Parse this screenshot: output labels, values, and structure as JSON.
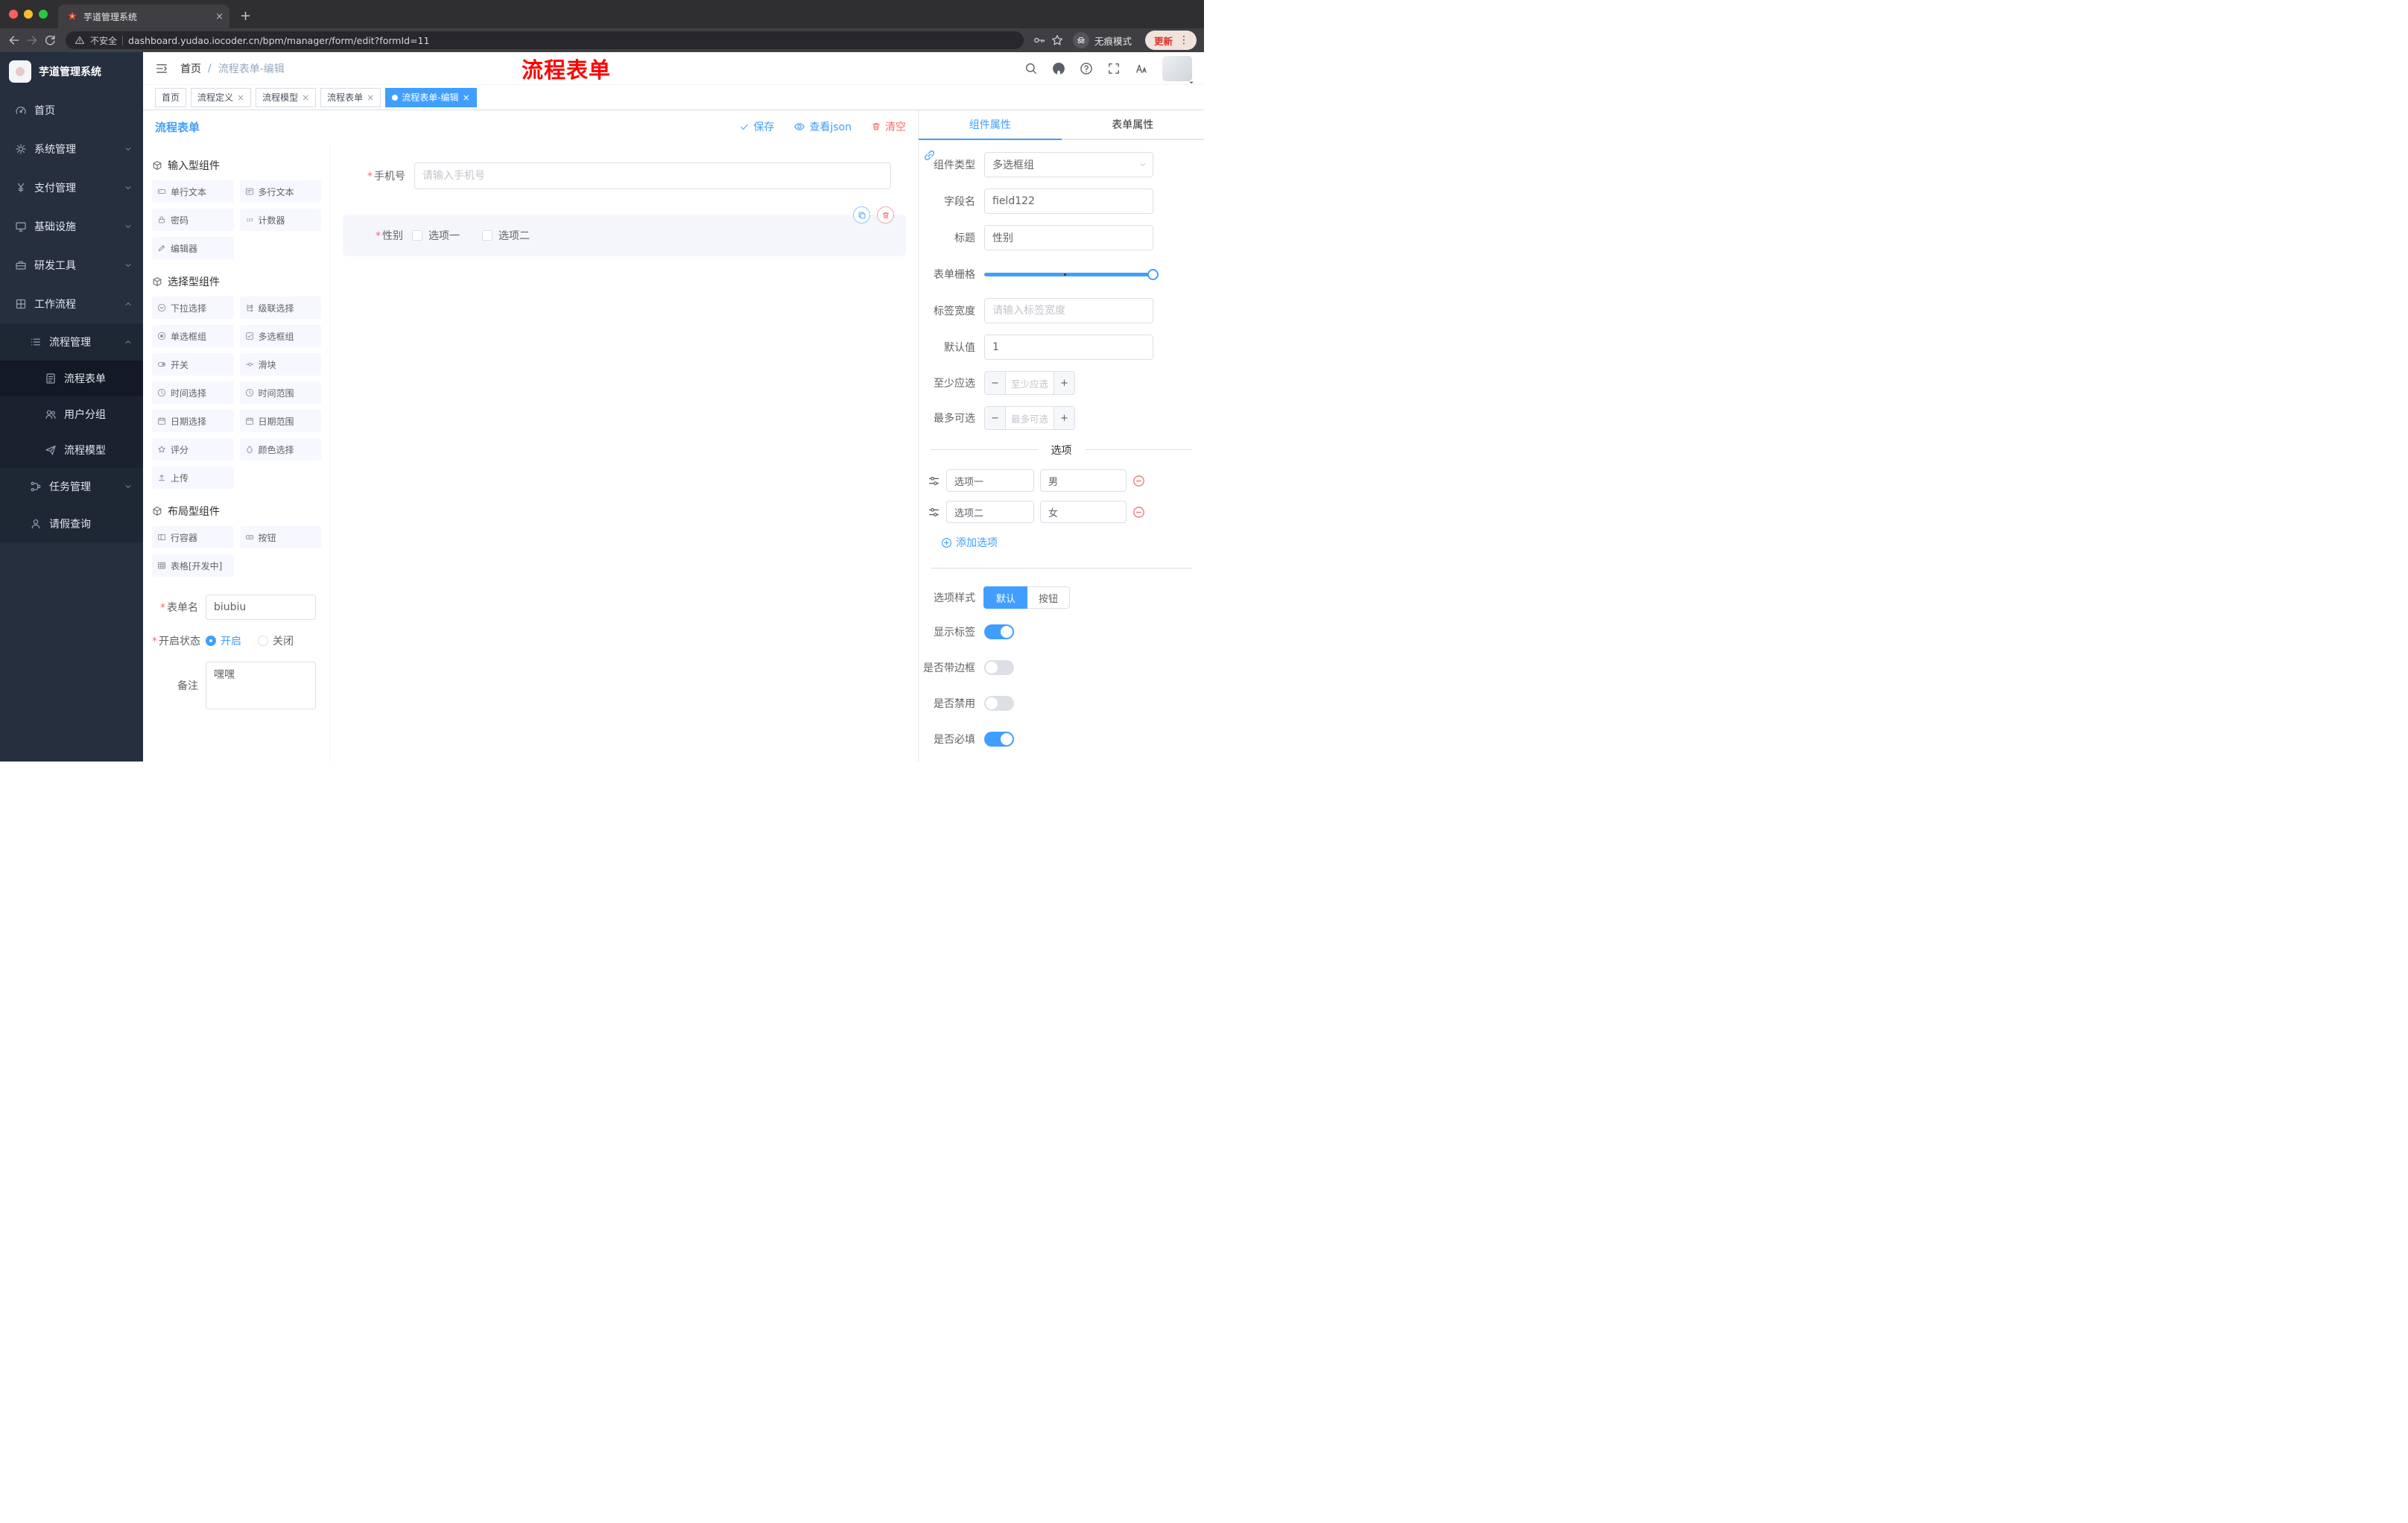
{
  "symbols": {
    "required": "*",
    "close": "×",
    "plus": "+",
    "minus": "−",
    "kebab": "⋮",
    "slash": "/"
  },
  "browser": {
    "tab_title": "芋道管理系统",
    "security_label": "不安全",
    "url": "dashboard.yudao.iocoder.cn/bpm/manager/form/edit?formId=11",
    "incognito_label": "无痕模式",
    "update_label": "更新"
  },
  "sidebar": {
    "logo_title": "芋道管理系统",
    "items": [
      {
        "label": "首页"
      },
      {
        "label": "系统管理"
      },
      {
        "label": "支付管理"
      },
      {
        "label": "基础设施"
      },
      {
        "label": "研发工具"
      },
      {
        "label": "工作流程"
      },
      {
        "label": "流程管理"
      },
      {
        "label": "流程表单"
      },
      {
        "label": "用户分组"
      },
      {
        "label": "流程模型"
      },
      {
        "label": "任务管理"
      },
      {
        "label": "请假查询"
      }
    ]
  },
  "navbar": {
    "breadcrumb_home": "首页",
    "breadcrumb_current": "流程表单-编辑",
    "annotation": "流程表单"
  },
  "tags": [
    {
      "label": "首页"
    },
    {
      "label": "流程定义"
    },
    {
      "label": "流程模型"
    },
    {
      "label": "流程表单"
    },
    {
      "label": "流程表单-编辑"
    }
  ],
  "editor": {
    "title": "流程表单",
    "save": "保存",
    "view_json": "查看json",
    "clear": "清空"
  },
  "palette": {
    "groups": [
      {
        "title": "输入型组件",
        "items": [
          "单行文本",
          "多行文本",
          "密码",
          "计数器",
          "编辑器"
        ]
      },
      {
        "title": "选择型组件",
        "items": [
          "下拉选择",
          "级联选择",
          "单选框组",
          "多选框组",
          "开关",
          "滑块",
          "时间选择",
          "时间范围",
          "日期选择",
          "日期范围",
          "评分",
          "颜色选择",
          "上传"
        ]
      },
      {
        "title": "布局型组件",
        "items": [
          "行容器",
          "按钮",
          "表格[开发中]"
        ]
      }
    ],
    "meta": {
      "name_label": "表单名",
      "name_value": "biubiu",
      "status_label": "开启状态",
      "status_on": "开启",
      "status_off": "关闭",
      "remark_label": "备注",
      "remark_value": "嘿嘿"
    }
  },
  "canvas": {
    "phone": {
      "label": "手机号",
      "placeholder": "请输入手机号"
    },
    "gender": {
      "label": "性别",
      "option1": "选项一",
      "option2": "选项二"
    }
  },
  "props": {
    "tab_component": "组件属性",
    "tab_form": "表单属性",
    "component_type_label": "组件类型",
    "component_type_value": "多选框组",
    "field_name_label": "字段名",
    "field_name_value": "field122",
    "title_label": "标题",
    "title_value": "性别",
    "grid_label": "表单栅格",
    "label_width_label": "标签宽度",
    "label_width_placeholder": "请输入标签宽度",
    "default_label": "默认值",
    "default_value": "1",
    "min_label": "至少应选",
    "min_placeholder": "至少应选",
    "max_label": "最多可选",
    "max_placeholder": "最多可选",
    "options_title": "选项",
    "options": [
      {
        "name": "选项一",
        "value": "男"
      },
      {
        "name": "选项二",
        "value": "女"
      }
    ],
    "add_option": "添加选项",
    "style_label": "选项样式",
    "style_default": "默认",
    "style_button": "按钮",
    "toggle_show_label": "显示标签",
    "toggle_border": "是否带边框",
    "toggle_disabled": "是否禁用",
    "toggle_required": "是否必填"
  },
  "colors": {
    "accent": "#409eff",
    "danger": "#f56c6c",
    "annotation": "#ff0000",
    "active_tag": "#409eff"
  }
}
